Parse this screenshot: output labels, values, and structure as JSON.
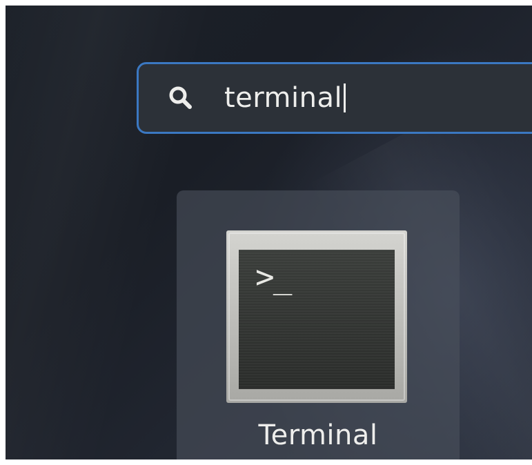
{
  "search": {
    "icon": "search-icon",
    "value": "terminal",
    "accent_color": "#3b78c2"
  },
  "results": [
    {
      "icon": "terminal-icon",
      "label": "Terminal",
      "prompt_glyph": ">_"
    }
  ]
}
